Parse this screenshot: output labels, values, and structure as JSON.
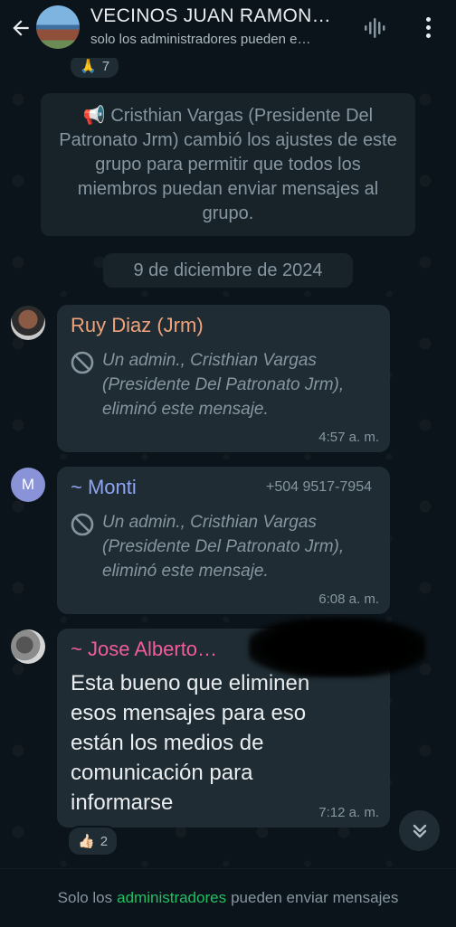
{
  "header": {
    "title": "VECINOS JUAN RAMON…",
    "subtitle": "solo los administradores pueden e…",
    "back_icon": "arrow-left-icon",
    "voice_icon": "audio-wave-icon",
    "menu_icon": "more-vertical-icon"
  },
  "top_reaction": {
    "emoji": "🙏",
    "count": "7"
  },
  "system_message": {
    "icon": "📢",
    "text": "Cristhian Vargas (Presidente Del Patronato Jrm) cambió los ajustes de este grupo para permitir que todos los miembros puedan enviar mensajes al grupo."
  },
  "date_chip": "9 de diciembre de 2024",
  "messages": [
    {
      "sender": "Ruy Diaz (Jrm)",
      "sender_color": "#f0a37a",
      "deleted_text": "Un admin., Cristhian Vargas (Presidente Del Patronato Jrm), eliminó este mensaje.",
      "time": "4:57 a. m."
    },
    {
      "sender": "~ Monti",
      "sender_color": "#8fa4f2",
      "avatar_letter": "M",
      "phone": "+504 9517-7954",
      "deleted_text": "Un admin., Cristhian Vargas (Presidente Del Patronato Jrm), eliminó este mensaje.",
      "time": "6:08 a. m."
    },
    {
      "sender": "~ Jose Alberto…",
      "sender_color": "#f25c9a",
      "text": "Esta bueno que eliminen esos mensajes para eso están los medios de comunicación para informarse",
      "time": "7:12 a. m.",
      "reaction": {
        "emoji": "👍🏻",
        "count": "2"
      }
    }
  ],
  "footer": {
    "prefix": "Solo los",
    "highlight": "administradores",
    "suffix": "pueden enviar mensajes",
    "highlight_color": "#21c063"
  }
}
